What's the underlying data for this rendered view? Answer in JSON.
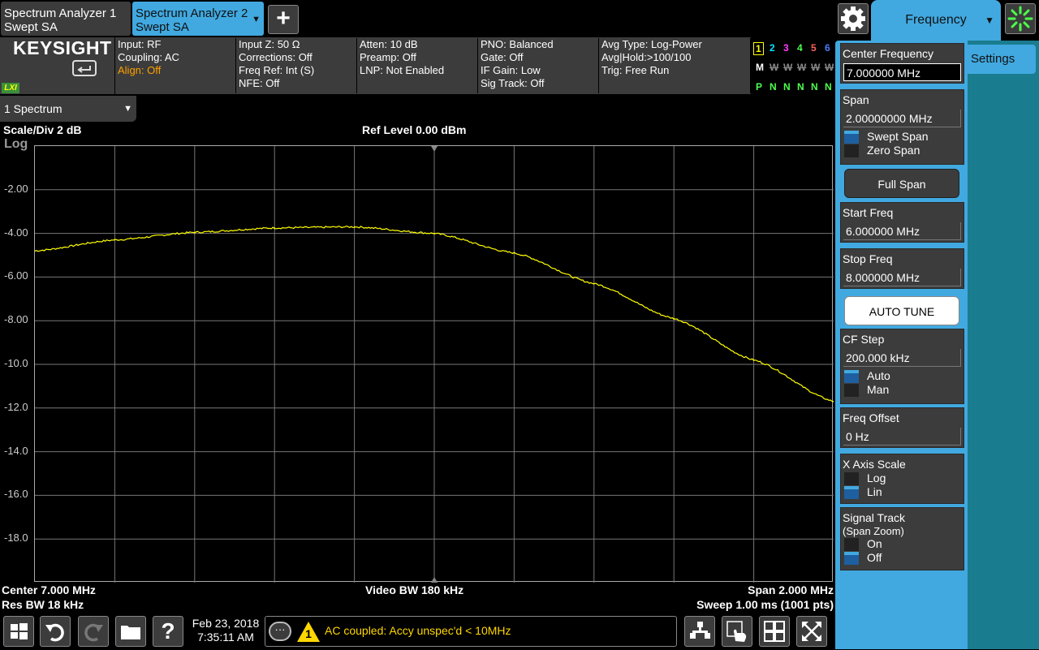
{
  "tabs": [
    {
      "line1": "Spectrum Analyzer 1",
      "line2": "Swept SA"
    },
    {
      "line1": "Spectrum Analyzer 2",
      "line2": "Swept SA"
    }
  ],
  "menu": {
    "title": "Frequency",
    "settings_tab": "Settings"
  },
  "brand": {
    "name": "KEYSIGHT",
    "lxi": "LXI"
  },
  "info": {
    "col1": [
      "Input: RF",
      "Coupling: AC"
    ],
    "col1_warn": "Align: Off",
    "col2": [
      "Input Z: 50 Ω",
      "Corrections: Off",
      "Freq Ref: Int (S)",
      "NFE: Off"
    ],
    "col3": [
      "Atten: 10 dB",
      "Preamp: Off",
      "LNP: Not Enabled"
    ],
    "col4": [
      "PNO: Balanced",
      "Gate: Off",
      "IF Gain: Low",
      "Sig Track: Off"
    ],
    "col5": [
      "Avg Type: Log-Power",
      "Avg|Hold:>100/100",
      "Trig: Free Run"
    ]
  },
  "traces": {
    "nums": [
      "1",
      "2",
      "3",
      "4",
      "5",
      "6"
    ],
    "num_colors": [
      "#ffff00",
      "#00e5ff",
      "#ff40ff",
      "#4cff4c",
      "#ff6060",
      "#4a7dff"
    ],
    "row_m": [
      "M",
      "W",
      "W",
      "W",
      "W",
      "W"
    ],
    "row_p": [
      "P",
      "N",
      "N",
      "N",
      "N",
      "N"
    ]
  },
  "window": {
    "selector": "1 Spectrum"
  },
  "graph": {
    "scale_div": "Scale/Div 2 dB",
    "scale_type": "Log",
    "ref_level": "Ref Level 0.00 dBm",
    "center": "Center 7.000 MHz",
    "res_bw": "Res BW 18 kHz",
    "video_bw": "Video BW 180 kHz",
    "span": "Span 2.000 MHz",
    "sweep": "Sweep 1.00 ms (1001 pts)",
    "y_labels": [
      "-2.00",
      "-4.00",
      "-6.00",
      "-8.00",
      "-10.0",
      "-12.0",
      "-14.0",
      "-16.0",
      "-18.0"
    ],
    "trace_color": "#ffff00"
  },
  "chart_data": {
    "type": "line",
    "title": "Ref Level 0.00 dBm",
    "xlabel": "",
    "ylabel": "",
    "xlim": [
      6.0,
      8.0
    ],
    "ylim": [
      -20,
      0
    ],
    "grid": true,
    "series": [
      {
        "x": [
          6.0,
          6.2,
          6.4,
          6.6,
          6.8,
          7.0,
          7.2,
          7.4,
          7.6,
          7.8,
          8.0
        ],
        "y": [
          -4.8,
          -4.3,
          -3.95,
          -3.75,
          -3.7,
          -4.0,
          -4.9,
          -6.3,
          -7.9,
          -9.8,
          -11.7
        ]
      }
    ]
  },
  "controls": {
    "center_freq": {
      "label": "Center Frequency",
      "value": "7.000000 MHz"
    },
    "span": {
      "label": "Span",
      "value": "2.00000000 MHz",
      "opt1": "Swept Span",
      "opt2": "Zero Span"
    },
    "full_span": "Full Span",
    "start_freq": {
      "label": "Start Freq",
      "value": "6.000000 MHz"
    },
    "stop_freq": {
      "label": "Stop Freq",
      "value": "8.000000 MHz"
    },
    "auto_tune": "AUTO TUNE",
    "cf_step": {
      "label": "CF Step",
      "value": "200.000 kHz",
      "opt1": "Auto",
      "opt2": "Man"
    },
    "freq_offset": {
      "label": "Freq Offset",
      "value": "0 Hz"
    },
    "x_axis": {
      "label": "X Axis Scale",
      "opt1": "Log",
      "opt2": "Lin"
    },
    "signal_track": {
      "label": "Signal Track",
      "sub": "(Span Zoom)",
      "opt1": "On",
      "opt2": "Off"
    }
  },
  "status": {
    "date": "Feb 23, 2018",
    "time": "7:35:11 AM",
    "message": "AC coupled: Accy unspec'd < 10MHz",
    "alert_count": "1"
  }
}
